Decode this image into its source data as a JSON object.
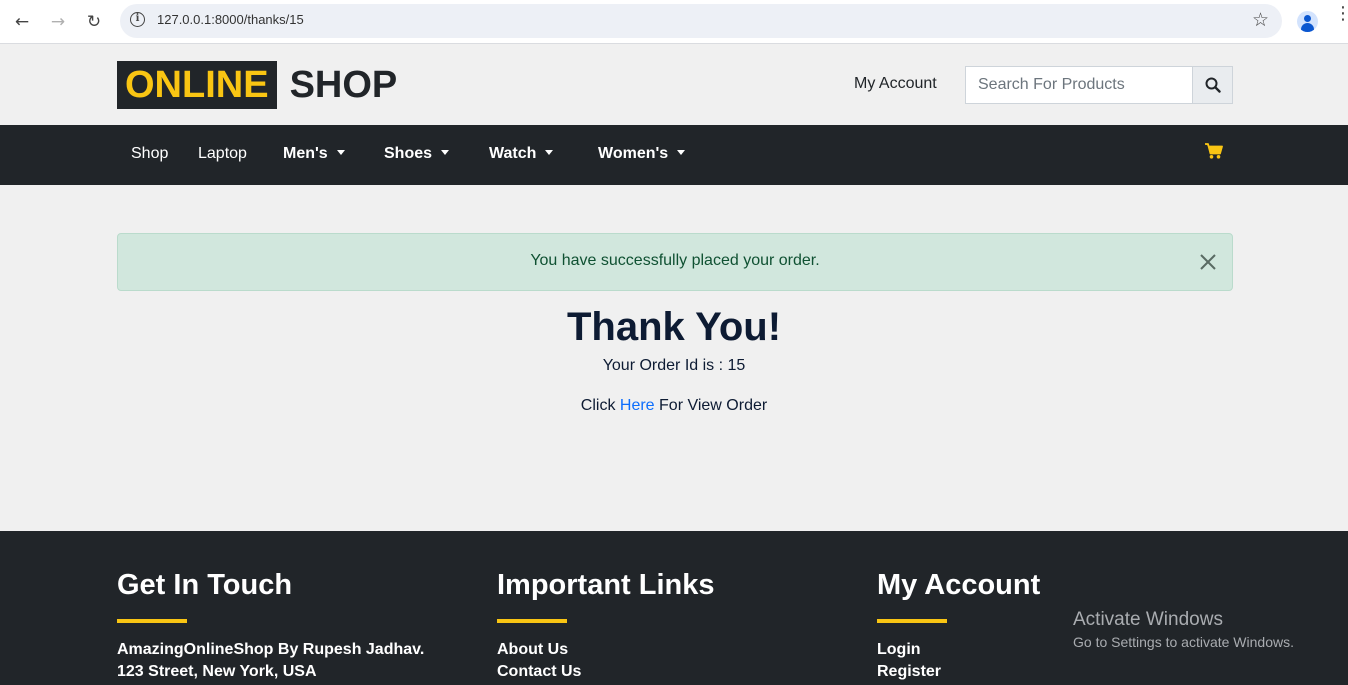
{
  "browser": {
    "url": "127.0.0.1:8000/thanks/15"
  },
  "header": {
    "logo_part1": "ONLINE",
    "logo_part2": "SHOP",
    "my_account": "My Account",
    "search_placeholder": "Search For Products"
  },
  "navbar": {
    "items": [
      {
        "label": "Shop"
      },
      {
        "label": "Laptop"
      },
      {
        "label": "Men's"
      },
      {
        "label": "Shoes"
      },
      {
        "label": "Watch"
      },
      {
        "label": "Women's"
      }
    ]
  },
  "alert": {
    "message": "You have successfully placed your order."
  },
  "main": {
    "title": "Thank You!",
    "order_id_label": "Your Order Id is : ",
    "order_id": "15",
    "view_prefix": "Click ",
    "view_link": "Here",
    "view_suffix": " For View Order"
  },
  "footer": {
    "col1_title": "Get In Touch",
    "col1_line1": "AmazingOnlineShop By Rupesh Jadhav.",
    "col1_line2": "123 Street, New York, USA",
    "col2_title": "Important Links",
    "col2_line1": "About Us",
    "col2_line2": "Contact Us",
    "col3_title": "My Account",
    "col3_line1": "Login",
    "col3_line2": "Register"
  },
  "watermark": {
    "title": "Activate Windows",
    "subtitle": "Go to Settings to activate Windows."
  },
  "colors": {
    "accent": "#f9c513",
    "dark": "#212529",
    "link": "#0d6efd",
    "alert_bg": "#d1e7dd"
  }
}
